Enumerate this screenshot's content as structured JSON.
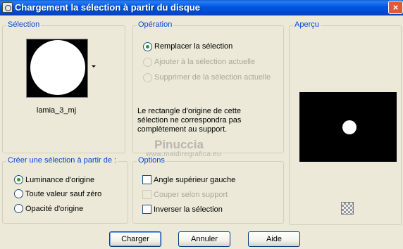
{
  "window": {
    "title": "Chargement la sélection à partir du disque",
    "close_glyph": "×"
  },
  "selection": {
    "legend": "Sélection",
    "file_name": "lamia_3_mj"
  },
  "operation": {
    "legend": "Opération",
    "options": [
      {
        "label": "Remplacer la sélection",
        "checked": true,
        "disabled": false
      },
      {
        "label": "Ajouter à la sélection actuelle",
        "checked": false,
        "disabled": true
      },
      {
        "label": "Supprimer de la sélection actuelle",
        "checked": false,
        "disabled": true
      }
    ],
    "note": "Le rectangle d'origine de cette sélection ne correspondra pas complètement au support."
  },
  "preview": {
    "legend": "Aperçu"
  },
  "create_from": {
    "legend": "Créer une sélection à partir de :",
    "options": [
      {
        "label": "Luminance d'origine",
        "checked": true
      },
      {
        "label": "Toute valeur sauf zéro",
        "checked": false
      },
      {
        "label": "Opacité d'origine",
        "checked": false
      }
    ]
  },
  "options": {
    "legend": "Options",
    "items": [
      {
        "label": "Angle supérieur gauche",
        "checked": false,
        "disabled": false
      },
      {
        "label": "Couper selon support",
        "checked": false,
        "disabled": true
      },
      {
        "label": "Inverser la sélection",
        "checked": false,
        "disabled": false
      }
    ]
  },
  "watermark": {
    "line1": "Pinuccia",
    "line2": "www.maidiregrafica.eu"
  },
  "buttons": {
    "load": "Charger",
    "cancel": "Annuler",
    "help": "Aide"
  },
  "icons": {
    "window": "window-icon",
    "dropdown": "chevron-down-icon",
    "checker": "checkerboard-icon"
  }
}
